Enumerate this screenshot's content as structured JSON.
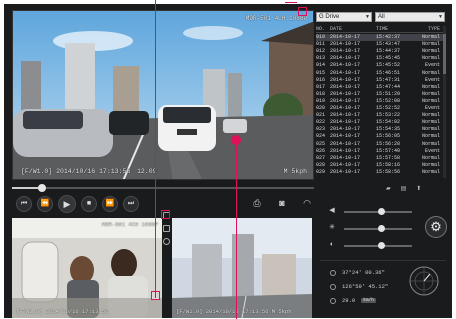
{
  "main_video": {
    "osd_top": "MDR-501 4CH 1080P",
    "osd_bottom": "[F/W1.0] 2014/10/16 17:13:56",
    "osd_mid": "12.09",
    "osd_speed": "M 5kph"
  },
  "progress": {
    "fraction": 0.1
  },
  "sub_video_1": {
    "osd_top": "MDR-501 4CH 1080P",
    "osd_bottom": "[F/W1.0] 2014/10/16 17:13:56"
  },
  "sub_video_2": {
    "osd_bottom": "[F/W1.0] 2014/10/16 17:13:56 M 5kph"
  },
  "filters": {
    "drive": "G Drive",
    "category": "All"
  },
  "list": {
    "headers": [
      "NO.",
      "DATE",
      "TIME",
      "TYPE"
    ],
    "rows": [
      [
        "010",
        "2014-10-17",
        "15:42:37",
        "Normal"
      ],
      [
        "011",
        "2014-10-17",
        "15:43:47",
        "Normal"
      ],
      [
        "012",
        "2014-10-17",
        "15:44:37",
        "Normal"
      ],
      [
        "013",
        "2014-10-17",
        "15:45:45",
        "Normal"
      ],
      [
        "014",
        "2014-10-17",
        "15:45:52",
        "Event"
      ],
      [
        "015",
        "2014-10-17",
        "15:46:51",
        "Normal"
      ],
      [
        "016",
        "2014-10-17",
        "15:47:31",
        "Event"
      ],
      [
        "017",
        "2014-10-17",
        "15:47:44",
        "Normal"
      ],
      [
        "018",
        "2014-10-17",
        "15:51:20",
        "Normal"
      ],
      [
        "019",
        "2014-10-17",
        "15:52:08",
        "Normal"
      ],
      [
        "020",
        "2014-10-17",
        "15:52:52",
        "Event"
      ],
      [
        "021",
        "2014-10-17",
        "15:53:22",
        "Normal"
      ],
      [
        "022",
        "2014-10-17",
        "15:54:02",
        "Normal"
      ],
      [
        "023",
        "2014-10-17",
        "15:54:35",
        "Normal"
      ],
      [
        "024",
        "2014-10-17",
        "15:56:05",
        "Normal"
      ],
      [
        "025",
        "2014-10-17",
        "15:56:28",
        "Normal"
      ],
      [
        "026",
        "2014-10-17",
        "15:57:40",
        "Event"
      ],
      [
        "027",
        "2014-10-17",
        "15:57:58",
        "Normal"
      ],
      [
        "028",
        "2014-10-17",
        "15:58:16",
        "Normal"
      ],
      [
        "029",
        "2014-10-17",
        "15:58:56",
        "Normal"
      ]
    ],
    "selected_index": 0
  },
  "sliders": [
    {
      "icon": "volume-icon",
      "level": 0.55
    },
    {
      "icon": "brightness-icon",
      "level": 0.55
    },
    {
      "icon": "contrast-icon",
      "level": 0.55
    }
  ],
  "gps": {
    "lat": "37°24' 00.36\"",
    "lon": "126°59' 45.12\"",
    "speed": "29.0",
    "unit": "km/h"
  },
  "colors": {
    "annotation": "#e0105a",
    "panel_bg": "#1a1b1d"
  }
}
